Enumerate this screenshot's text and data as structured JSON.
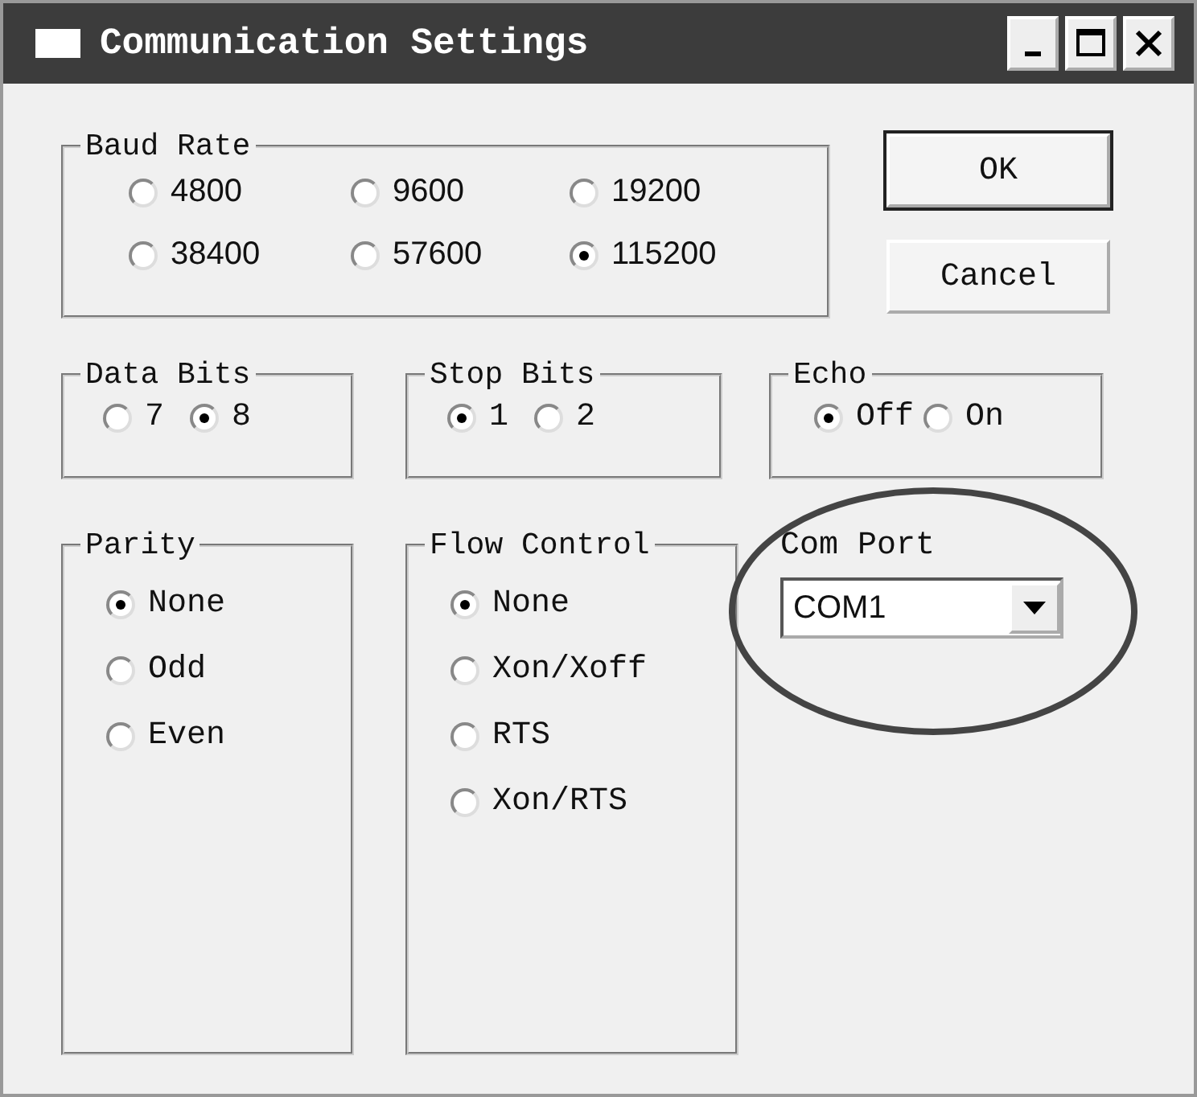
{
  "window": {
    "title": "Communication Settings"
  },
  "baud_rate": {
    "label": "Baud Rate",
    "options": [
      {
        "label": "4800",
        "selected": false
      },
      {
        "label": "9600",
        "selected": false
      },
      {
        "label": "19200",
        "selected": false
      },
      {
        "label": "38400",
        "selected": false
      },
      {
        "label": "57600",
        "selected": false
      },
      {
        "label": "115200",
        "selected": true
      }
    ]
  },
  "buttons": [
    "OK",
    "Cancel"
  ],
  "data_bits": {
    "label": "Data Bits",
    "options": [
      {
        "label": "7",
        "selected": false
      },
      {
        "label": "8",
        "selected": true
      }
    ]
  },
  "stop_bits": {
    "label": "Stop Bits",
    "options": [
      {
        "label": "1",
        "selected": true
      },
      {
        "label": "2",
        "selected": false
      }
    ]
  },
  "echo": {
    "label": "Echo",
    "options": [
      {
        "label": "Off",
        "selected": true
      },
      {
        "label": "On",
        "selected": false
      }
    ]
  },
  "parity": {
    "label": "Parity",
    "options": [
      {
        "label": "None",
        "selected": true
      },
      {
        "label": "Odd",
        "selected": false
      },
      {
        "label": "Even",
        "selected": false
      }
    ]
  },
  "flow_control": {
    "label": "Flow Control",
    "options": [
      {
        "label": "None",
        "selected": true
      },
      {
        "label": "Xon/Xoff",
        "selected": false
      },
      {
        "label": "RTS",
        "selected": false
      },
      {
        "label": "Xon/RTS",
        "selected": false
      }
    ]
  },
  "com_port": {
    "label": "Com Port",
    "value": "COM1"
  }
}
